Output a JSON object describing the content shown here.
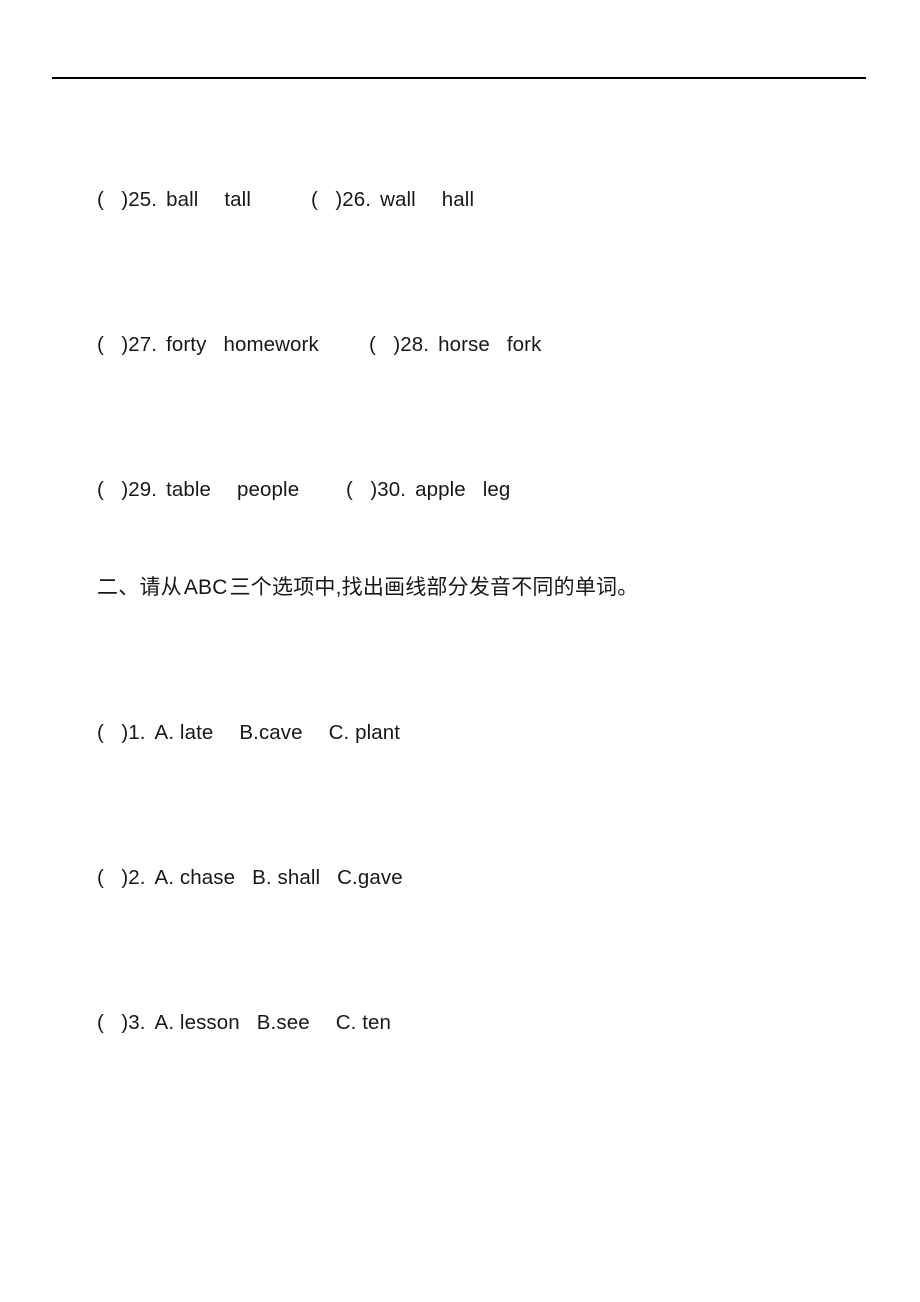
{
  "page": {
    "background_color": "#ffffff",
    "text_color": "#16181a",
    "rule_color": "#000000"
  },
  "section_one_continued": {
    "rows": [
      {
        "left": {
          "brackets": "(   )",
          "number": "25.",
          "words": [
            "ball",
            "tall"
          ]
        },
        "right": {
          "brackets": "(   )",
          "number": "26.",
          "words": [
            "wall",
            "hall"
          ]
        }
      },
      {
        "left": {
          "brackets": "(   )",
          "number": "27.",
          "words": [
            "forty",
            "homework"
          ]
        },
        "right": {
          "brackets": "(   )",
          "number": "28.",
          "words": [
            "horse",
            "fork"
          ]
        }
      },
      {
        "left": {
          "brackets": "(   )",
          "number": "29.",
          "words": [
            "table",
            "people"
          ]
        },
        "right": {
          "brackets": "(   )",
          "number": "30.",
          "words": [
            "apple",
            "leg"
          ]
        }
      }
    ]
  },
  "section_two": {
    "heading": {
      "prefix": "二、请从",
      "latin": "ABC",
      "suffix": "三个选项中,找出画线部分发音不同的单词。",
      "full": "二、请从 ABC 三个选项中,找出画线部分发音不同的单词。"
    },
    "questions": [
      {
        "brackets": "(   )",
        "number": "1.",
        "options": [
          "A. late",
          "B.cave",
          "C. plant"
        ]
      },
      {
        "brackets": "(   )",
        "number": "2.",
        "options": [
          "A. chase",
          "B. shall",
          "C.gave"
        ]
      },
      {
        "brackets": "(   )",
        "number": "3.",
        "options": [
          "A. lesson",
          "B.see",
          "C. ten"
        ]
      }
    ]
  }
}
